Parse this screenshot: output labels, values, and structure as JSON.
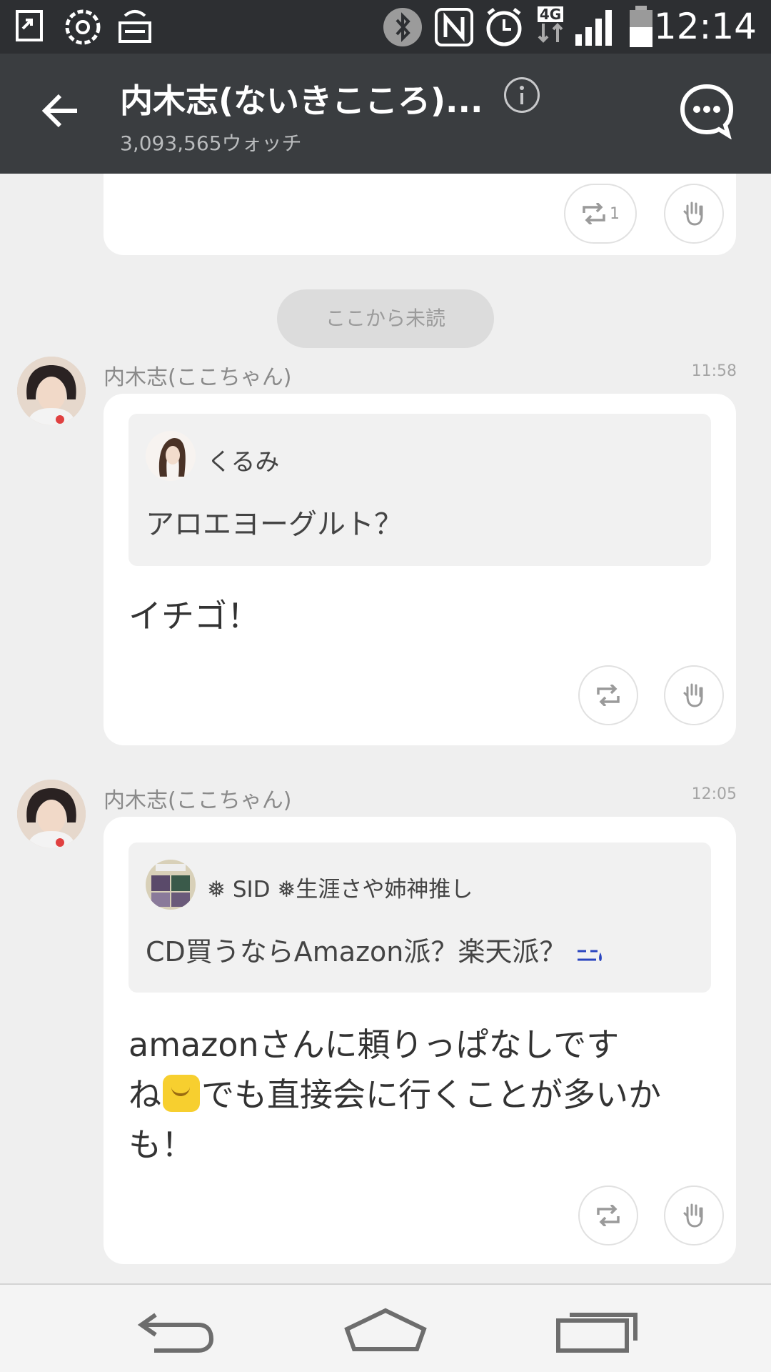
{
  "status_bar": {
    "time": "12:14",
    "network_label": "4G",
    "icons": [
      "screen-mirror-icon",
      "settings-flower-icon",
      "keyboard-icon",
      "bluetooth-icon",
      "nfc-icon",
      "alarm-icon",
      "network-4g-icon",
      "signal-icon",
      "battery-icon"
    ]
  },
  "header": {
    "title": "内木志(ないきこころ)...",
    "subtitle": "3,093,565ウォッチ",
    "icons": [
      "back-arrow-icon",
      "info-icon",
      "chat-bubble-icon"
    ]
  },
  "top_card": {
    "retweet_count": "1"
  },
  "unread_divider": "ここから未読",
  "messages": [
    {
      "sender": "内木志(ここちゃん)",
      "time": "11:58",
      "quote": {
        "name": "くるみ",
        "text": "アロエヨーグルト？"
      },
      "reply": "イチゴ！"
    },
    {
      "sender": "内木志(ここちゃん)",
      "time": "12:05",
      "quote": {
        "name": "❅ SID ❅生涯さや姉神推し",
        "text": "CD買うならAmazon派？楽天派？"
      },
      "reply_line1": "amazonさんに頼りっぱなしです",
      "reply_line2a": "ね",
      "reply_line2b": "でも直接会に行くことが多いか",
      "reply_line3": "も！"
    }
  ],
  "colors": {
    "status_bar": "#2d2f32",
    "header": "#3a3d40",
    "background": "#efefef",
    "card": "#ffffff",
    "quote": "#f1f1f1"
  },
  "navbar": {
    "icons": [
      "back-nav-icon",
      "home-nav-icon",
      "recents-nav-icon"
    ]
  }
}
